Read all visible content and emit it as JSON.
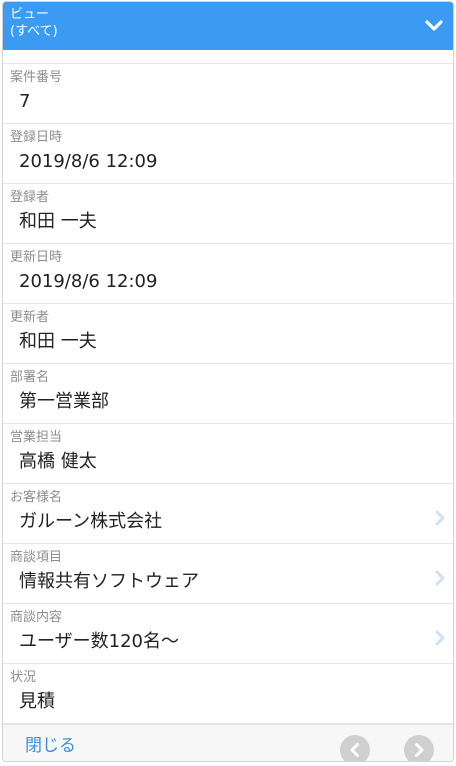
{
  "header": {
    "title": "ビュー",
    "subtitle": "(すべて)",
    "toggle_icon": "chevron-down-icon"
  },
  "fields": [
    {
      "id": "case-number",
      "label": "案件番号",
      "value": "7",
      "link": false
    },
    {
      "id": "created-at",
      "label": "登録日時",
      "value": "2019/8/6 12:09",
      "link": false
    },
    {
      "id": "created-by",
      "label": "登録者",
      "value": "和田 一夫",
      "link": false
    },
    {
      "id": "updated-at",
      "label": "更新日時",
      "value": "2019/8/6 12:09",
      "link": false
    },
    {
      "id": "updated-by",
      "label": "更新者",
      "value": "和田 一夫",
      "link": false
    },
    {
      "id": "department",
      "label": "部署名",
      "value": "第一営業部",
      "link": false
    },
    {
      "id": "sales-rep",
      "label": "営業担当",
      "value": "高橋 健太",
      "link": false
    },
    {
      "id": "customer-name",
      "label": "お客様名",
      "value": "ガルーン株式会社",
      "link": true
    },
    {
      "id": "deal-item",
      "label": "商談項目",
      "value": "情報共有ソフトウェア",
      "link": true
    },
    {
      "id": "deal-content",
      "label": "商談内容",
      "value": "ユーザー数120名～",
      "link": true
    },
    {
      "id": "status",
      "label": "状況",
      "value": "見積",
      "link": false
    }
  ],
  "footer": {
    "close_label": "閉じる",
    "prev_icon": "chevron-left-icon",
    "next_icon": "chevron-right-icon"
  },
  "colors": {
    "header_bg": "#3b9bf2",
    "link_blue": "#3b8fd9",
    "label_gray": "#8d8d8d",
    "arrow_light": "#cfe2f5",
    "nav_button": "#cfcfcf"
  }
}
